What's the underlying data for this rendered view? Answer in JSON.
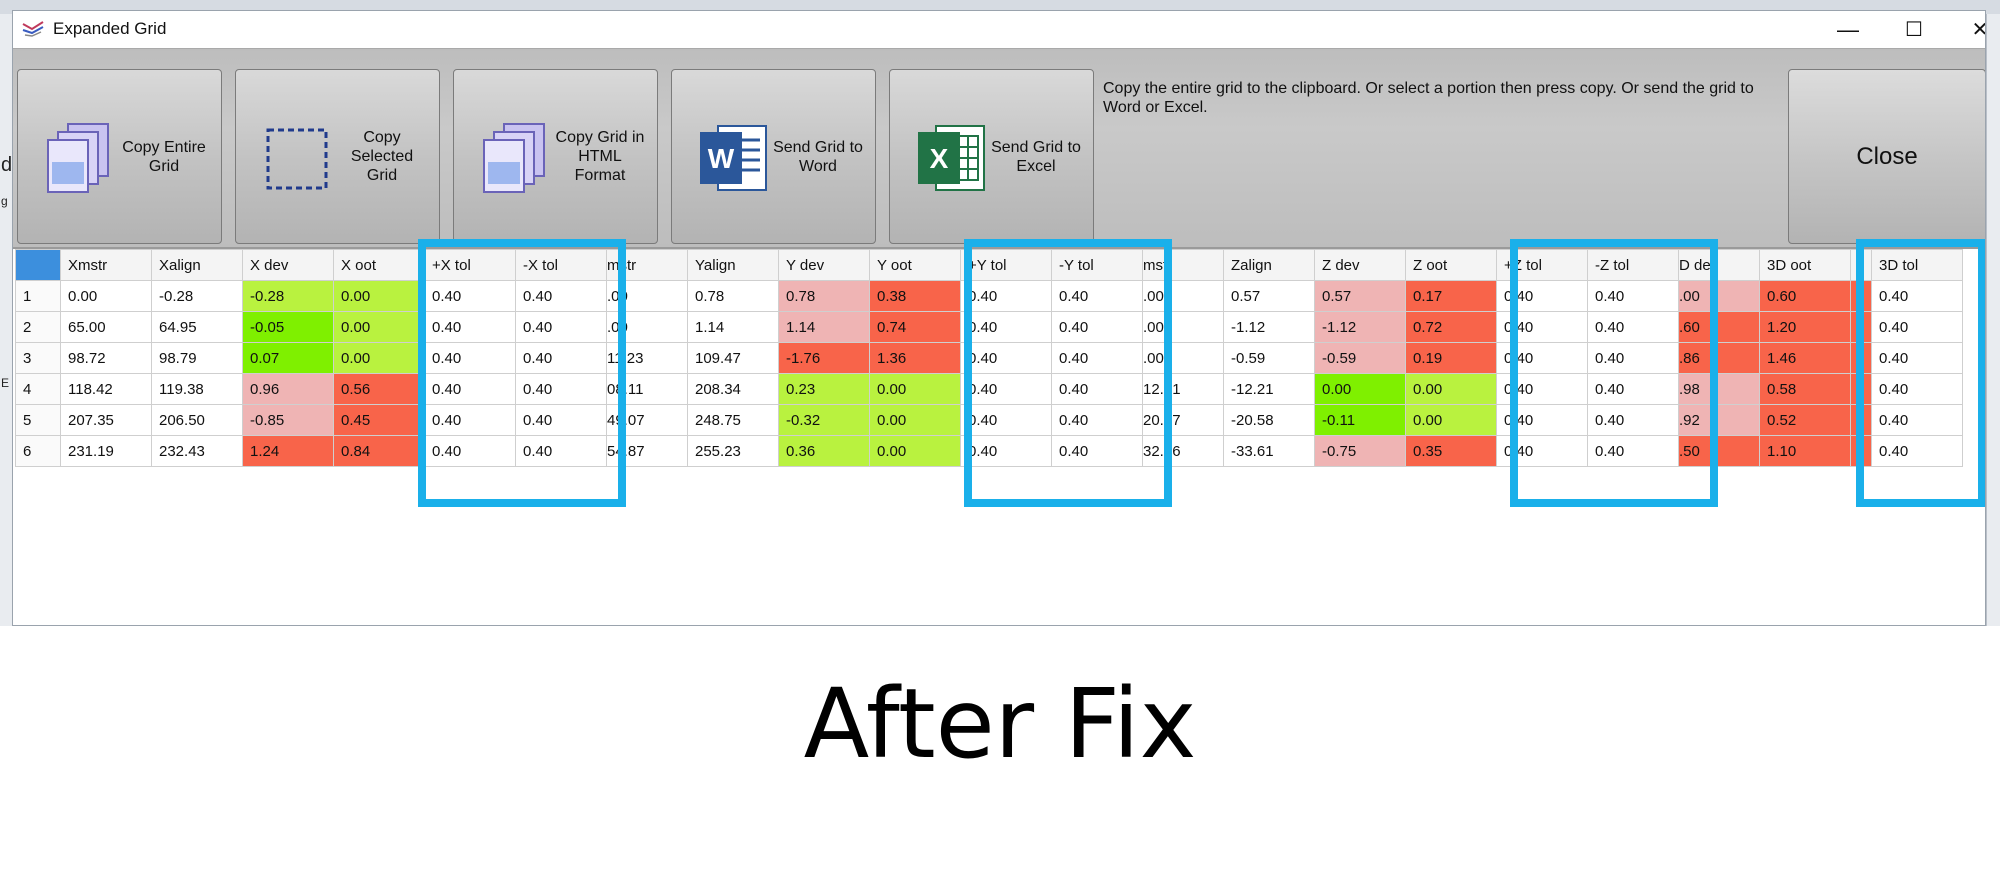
{
  "window": {
    "title": "Expanded Grid",
    "minimize": "—",
    "maximize": "☐",
    "close": "✕"
  },
  "background_fragments": [
    "d",
    "g",
    "E"
  ],
  "toolbar": {
    "buttons": [
      {
        "id": "copy-entire",
        "label": "Copy Entire\nGrid",
        "icon": "copy-pages-icon"
      },
      {
        "id": "copy-selected",
        "label": "Copy\nSelected\nGrid",
        "icon": "dashed-selection-icon"
      },
      {
        "id": "copy-html",
        "label": "Copy Grid in\nHTML\nFormat",
        "icon": "copy-pages-icon"
      },
      {
        "id": "send-word",
        "label": "Send Grid to\nWord",
        "icon": "word-icon"
      },
      {
        "id": "send-excel",
        "label": "Send Grid to\nExcel",
        "icon": "excel-icon"
      }
    ],
    "hint": "Copy the entire grid to the clipboard.  Or select a portion then press copy.  Or send the grid to Word or Excel.",
    "close_label": "Close"
  },
  "grid": {
    "headers": [
      "",
      "Xmstr",
      "Xalign",
      "X dev",
      "X oot",
      "+X tol",
      "-X tol",
      "mstr",
      "Yalign",
      "Y dev",
      "Y oot",
      "+Y tol",
      "-Y tol",
      "mstr",
      "Zalign",
      "Z dev",
      "Z oot",
      "+Z tol",
      "-Z tol",
      "D dev",
      "3D oot",
      "",
      "3D tol"
    ],
    "rows": [
      [
        "1",
        "0.00",
        "-0.28",
        "-0.28",
        "0.00",
        "0.40",
        "0.40",
        ".00",
        "0.78",
        "0.78",
        "0.38",
        "0.40",
        "0.40",
        ".00",
        "0.57",
        "0.57",
        "0.17",
        "0.40",
        "0.40",
        ".00",
        "0.60",
        "",
        "0.40"
      ],
      [
        "2",
        "65.00",
        "64.95",
        "-0.05",
        "0.00",
        "0.40",
        "0.40",
        ".00",
        "1.14",
        "1.14",
        "0.74",
        "0.40",
        "0.40",
        ".00",
        "-1.12",
        "-1.12",
        "0.72",
        "0.40",
        "0.40",
        ".60",
        "1.20",
        "",
        "0.40"
      ],
      [
        "3",
        "98.72",
        "98.79",
        "0.07",
        "0.00",
        "0.40",
        "0.40",
        "11.23",
        "109.47",
        "-1.76",
        "1.36",
        "0.40",
        "0.40",
        ".00",
        "-0.59",
        "-0.59",
        "0.19",
        "0.40",
        "0.40",
        ".86",
        "1.46",
        "",
        "0.40"
      ],
      [
        "4",
        "118.42",
        "119.38",
        "0.96",
        "0.56",
        "0.40",
        "0.40",
        "08.11",
        "208.34",
        "0.23",
        "0.00",
        "0.40",
        "0.40",
        "12.21",
        "-12.21",
        "0.00",
        "0.00",
        "0.40",
        "0.40",
        ".98",
        "0.58",
        "",
        "0.40"
      ],
      [
        "5",
        "207.35",
        "206.50",
        "-0.85",
        "0.45",
        "0.40",
        "0.40",
        "49.07",
        "248.75",
        "-0.32",
        "0.00",
        "0.40",
        "0.40",
        "20.47",
        "-20.58",
        "-0.11",
        "0.00",
        "0.40",
        "0.40",
        ".92",
        "0.52",
        "",
        "0.40"
      ],
      [
        "6",
        "231.19",
        "232.43",
        "1.24",
        "0.84",
        "0.40",
        "0.40",
        "54.87",
        "255.23",
        "0.36",
        "0.00",
        "0.40",
        "0.40",
        "32.86",
        "-33.61",
        "-0.75",
        "0.35",
        "0.40",
        "0.40",
        ".50",
        "1.10",
        "",
        "0.40"
      ]
    ],
    "cell_colors": [
      [
        null,
        null,
        null,
        "#b9f23f",
        "#b9f23f",
        null,
        null,
        null,
        null,
        "#efb4b4",
        "#f8644a",
        null,
        null,
        null,
        null,
        "#efb4b4",
        "#f8644a",
        null,
        null,
        "#efb4b4",
        "#f8644a",
        "#f8644a",
        null
      ],
      [
        null,
        null,
        null,
        "#7ff000",
        "#b9f23f",
        null,
        null,
        null,
        null,
        "#efb4b4",
        "#f8644a",
        null,
        null,
        null,
        null,
        "#efb4b4",
        "#f8644a",
        null,
        null,
        "#f8644a",
        "#f8644a",
        "#f8644a",
        null
      ],
      [
        null,
        null,
        null,
        "#7ff000",
        "#b9f23f",
        null,
        null,
        null,
        null,
        "#f8644a",
        "#f8644a",
        null,
        null,
        null,
        null,
        "#efb4b4",
        "#f8644a",
        null,
        null,
        "#f8644a",
        "#f8644a",
        "#f8644a",
        null
      ],
      [
        null,
        null,
        null,
        "#efb4b4",
        "#f8644a",
        null,
        null,
        null,
        null,
        "#b9f23f",
        "#b9f23f",
        null,
        null,
        null,
        null,
        "#7ff000",
        "#b9f23f",
        null,
        null,
        "#efb4b4",
        "#f8644a",
        "#f8644a",
        null
      ],
      [
        null,
        null,
        null,
        "#efb4b4",
        "#f8644a",
        null,
        null,
        null,
        null,
        "#b9f23f",
        "#b9f23f",
        null,
        null,
        null,
        null,
        "#7ff000",
        "#b9f23f",
        null,
        null,
        "#efb4b4",
        "#f8644a",
        "#f8644a",
        null
      ],
      [
        null,
        null,
        null,
        "#f8644a",
        "#f8644a",
        null,
        null,
        null,
        null,
        "#b9f23f",
        "#b9f23f",
        null,
        null,
        null,
        null,
        "#efb4b4",
        "#f8644a",
        null,
        null,
        "#f8644a",
        "#f8644a",
        "#f8644a",
        null
      ]
    ],
    "cut_columns": [
      7,
      13,
      19
    ]
  },
  "highlight_color": "#1ab0ea",
  "caption": "After Fix"
}
